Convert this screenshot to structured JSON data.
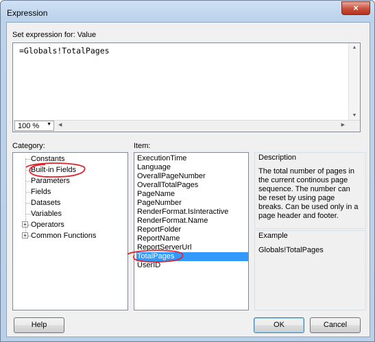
{
  "window": {
    "title": "Expression",
    "close_glyph": "×"
  },
  "expression": {
    "label": "Set expression for: Value",
    "text": "=Globals!TotalPages",
    "zoom": "100 %"
  },
  "category": {
    "label": "Category:",
    "items": [
      "Constants",
      "Built-in Fields",
      "Parameters",
      "Fields",
      "Datasets",
      "Variables",
      "Operators",
      "Common Functions"
    ]
  },
  "item": {
    "label": "Item:",
    "items": [
      "ExecutionTime",
      "Language",
      "OverallPageNumber",
      "OverallTotalPages",
      "PageName",
      "PageNumber",
      "RenderFormat.IsInteractive",
      "RenderFormat.Name",
      "ReportFolder",
      "ReportName",
      "ReportServerUrl",
      "TotalPages",
      "UserID"
    ],
    "selected": "TotalPages"
  },
  "description": {
    "title": "Description",
    "lines": [
      "The total number of pages in",
      "the current continous page",
      "sequence. The number can",
      "be reset by using page",
      "breaks. Can be used only in a",
      "page header and footer."
    ]
  },
  "example": {
    "title": "Example",
    "text": "Globals!TotalPages"
  },
  "buttons": {
    "help": "Help",
    "ok": "OK",
    "cancel": "Cancel"
  },
  "colors": {
    "selection": "#3399ff",
    "annotation": "#e2232b"
  }
}
